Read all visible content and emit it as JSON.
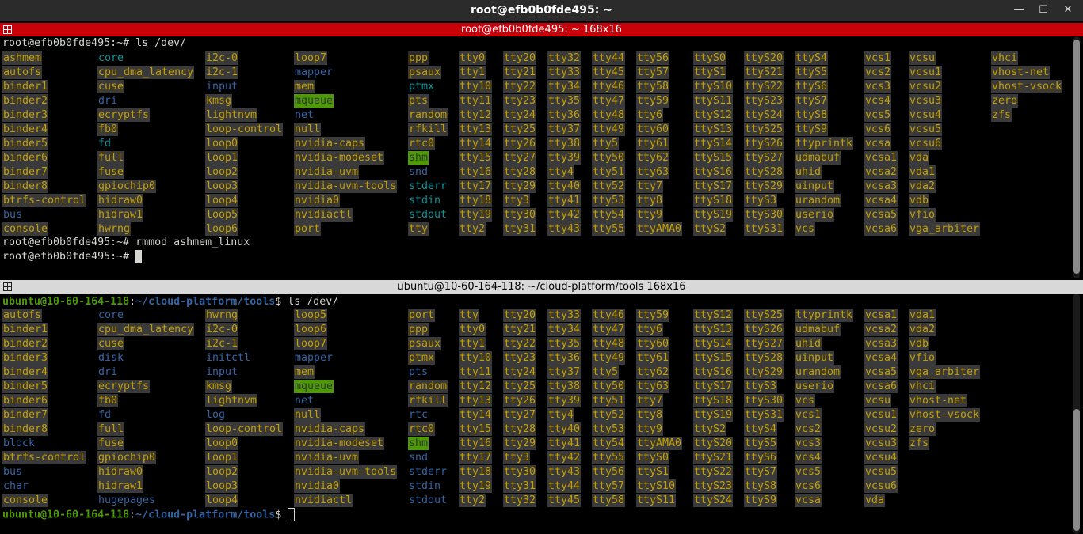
{
  "window": {
    "title": "root@efb0b0fde495: ~",
    "minimize_glyph": "—",
    "maximize_glyph": "☐",
    "close_glyph": "✕"
  },
  "pane1": {
    "header": "root@efb0b0fde495: ~ 168x16",
    "prompt1": "root@efb0b0fde495:~# ",
    "cmd1": "ls /dev/",
    "prompt2": "root@efb0b0fde495:~# ",
    "cmd2": "rmmod ashmem_linux",
    "prompt3": "root@efb0b0fde495:~# ",
    "cols": [
      [
        "ashmem",
        "autofs",
        "binder1",
        "binder2",
        "binder3",
        "binder4",
        "binder5",
        "binder6",
        "binder7",
        "binder8",
        "btrfs-control",
        "bus",
        "console"
      ],
      [
        "core",
        "cpu_dma_latency",
        "cuse",
        "dri",
        "ecryptfs",
        "fb0",
        "fd",
        "full",
        "fuse",
        "gpiochip0",
        "hidraw0",
        "hidraw1",
        "hwrng"
      ],
      [
        "i2c-0",
        "i2c-1",
        "input",
        "kmsg",
        "lightnvm",
        "loop-control",
        "loop0",
        "loop1",
        "loop2",
        "loop3",
        "loop4",
        "loop5",
        "loop6"
      ],
      [
        "loop7",
        "mapper",
        "mem",
        "mqueue",
        "net",
        "null",
        "nvidia-caps",
        "nvidia-modeset",
        "nvidia-uvm",
        "nvidia-uvm-tools",
        "nvidia0",
        "nvidiactl",
        "port"
      ],
      [
        "ppp",
        "psaux",
        "ptmx",
        "pts",
        "random",
        "rfkill",
        "rtc0",
        "shm",
        "snd",
        "stderr",
        "stdin",
        "stdout",
        "tty"
      ],
      [
        "tty0",
        "tty1",
        "tty10",
        "tty11",
        "tty12",
        "tty13",
        "tty14",
        "tty15",
        "tty16",
        "tty17",
        "tty18",
        "tty19",
        "tty2"
      ],
      [
        "tty20",
        "tty21",
        "tty22",
        "tty23",
        "tty24",
        "tty25",
        "tty26",
        "tty27",
        "tty28",
        "tty29",
        "tty3",
        "tty30",
        "tty31"
      ],
      [
        "tty32",
        "tty33",
        "tty34",
        "tty35",
        "tty36",
        "tty37",
        "tty38",
        "tty39",
        "tty4",
        "tty40",
        "tty41",
        "tty42",
        "tty43"
      ],
      [
        "tty44",
        "tty45",
        "tty46",
        "tty47",
        "tty48",
        "tty49",
        "tty5",
        "tty50",
        "tty51",
        "tty52",
        "tty53",
        "tty54",
        "tty55"
      ],
      [
        "tty56",
        "tty57",
        "tty58",
        "tty59",
        "tty6",
        "tty60",
        "tty61",
        "tty62",
        "tty63",
        "tty7",
        "tty8",
        "tty9",
        "ttyAMA0"
      ],
      [
        "ttyS0",
        "ttyS1",
        "ttyS10",
        "ttyS11",
        "ttyS12",
        "ttyS13",
        "ttyS14",
        "ttyS15",
        "ttyS16",
        "ttyS17",
        "ttyS18",
        "ttyS19",
        "ttyS2"
      ],
      [
        "ttyS20",
        "ttyS21",
        "ttyS22",
        "ttyS23",
        "ttyS24",
        "ttyS25",
        "ttyS26",
        "ttyS27",
        "ttyS28",
        "ttyS29",
        "ttyS3",
        "ttyS30",
        "ttyS31"
      ],
      [
        "ttyS4",
        "ttyS5",
        "ttyS6",
        "ttyS7",
        "ttyS8",
        "ttyS9",
        "ttyprintk",
        "udmabuf",
        "uhid",
        "uinput",
        "urandom",
        "userio",
        "vcs"
      ],
      [
        "vcs1",
        "vcs2",
        "vcs3",
        "vcs4",
        "vcs5",
        "vcs6",
        "vcsa",
        "vcsa1",
        "vcsa2",
        "vcsa3",
        "vcsa4",
        "vcsa5",
        "vcsa6"
      ],
      [
        "vcsu",
        "vcsu1",
        "vcsu2",
        "vcsu3",
        "vcsu4",
        "vcsu5",
        "vcsu6",
        "vda",
        "vda1",
        "vda2",
        "vdb",
        "vfio",
        "vga_arbiter"
      ],
      [
        "vhci",
        "vhost-net",
        "vhost-vsock",
        "zero",
        "zfs"
      ]
    ],
    "types": {
      "dir": [
        "bus",
        "dri",
        "input",
        "mapper",
        "net",
        "snd"
      ],
      "link": [
        "core",
        "fd",
        "ptmx",
        "stderr",
        "stdin",
        "stdout"
      ],
      "sticky": [
        "mqueue",
        "shm"
      ],
      "pipe": [
        "ppp"
      ]
    }
  },
  "pane2": {
    "header": "ubuntu@10-60-164-118: ~/cloud-platform/tools 168x16",
    "prompt_user": "ubuntu@10-60-164-118",
    "prompt_sep": ":",
    "prompt_path": "~/cloud-platform/tools",
    "prompt_end": "$ ",
    "cmd1": "ls /dev/",
    "cols": [
      [
        "autofs",
        "binder1",
        "binder2",
        "binder3",
        "binder4",
        "binder5",
        "binder6",
        "binder7",
        "binder8",
        "block",
        "btrfs-control",
        "bus",
        "char",
        "console"
      ],
      [
        "core",
        "cpu_dma_latency",
        "cuse",
        "disk",
        "dri",
        "ecryptfs",
        "fb0",
        "fd",
        "full",
        "fuse",
        "gpiochip0",
        "hidraw0",
        "hidraw1",
        "hugepages"
      ],
      [
        "hwrng",
        "i2c-0",
        "i2c-1",
        "initctl",
        "input",
        "kmsg",
        "lightnvm",
        "log",
        "loop-control",
        "loop0",
        "loop1",
        "loop2",
        "loop3",
        "loop4"
      ],
      [
        "loop5",
        "loop6",
        "loop7",
        "mapper",
        "mem",
        "mqueue",
        "net",
        "null",
        "nvidia-caps",
        "nvidia-modeset",
        "nvidia-uvm",
        "nvidia-uvm-tools",
        "nvidia0",
        "nvidiactl"
      ],
      [
        "port",
        "ppp",
        "psaux",
        "ptmx",
        "pts",
        "random",
        "rfkill",
        "rtc",
        "rtc0",
        "shm",
        "snd",
        "stderr",
        "stdin",
        "stdout"
      ],
      [
        "tty",
        "tty0",
        "tty1",
        "tty10",
        "tty11",
        "tty12",
        "tty13",
        "tty14",
        "tty15",
        "tty16",
        "tty17",
        "tty18",
        "tty19",
        "tty2"
      ],
      [
        "tty20",
        "tty21",
        "tty22",
        "tty23",
        "tty24",
        "tty25",
        "tty26",
        "tty27",
        "tty28",
        "tty29",
        "tty3",
        "tty30",
        "tty31",
        "tty32"
      ],
      [
        "tty33",
        "tty34",
        "tty35",
        "tty36",
        "tty37",
        "tty38",
        "tty39",
        "tty4",
        "tty40",
        "tty41",
        "tty42",
        "tty43",
        "tty44",
        "tty45"
      ],
      [
        "tty46",
        "tty47",
        "tty48",
        "tty49",
        "tty5",
        "tty50",
        "tty51",
        "tty52",
        "tty53",
        "tty54",
        "tty55",
        "tty56",
        "tty57",
        "tty58"
      ],
      [
        "tty59",
        "tty6",
        "tty60",
        "tty61",
        "tty62",
        "tty63",
        "tty7",
        "tty8",
        "tty9",
        "ttyAMA0",
        "ttyS0",
        "ttyS1",
        "ttyS10",
        "ttyS11"
      ],
      [
        "ttyS12",
        "ttyS13",
        "ttyS14",
        "ttyS15",
        "ttyS16",
        "ttyS17",
        "ttyS18",
        "ttyS19",
        "ttyS2",
        "ttyS20",
        "ttyS21",
        "ttyS22",
        "ttyS23",
        "ttyS24"
      ],
      [
        "ttyS25",
        "ttyS26",
        "ttyS27",
        "ttyS28",
        "ttyS29",
        "ttyS3",
        "ttyS30",
        "ttyS31",
        "ttyS4",
        "ttyS5",
        "ttyS6",
        "ttyS7",
        "ttyS8",
        "ttyS9"
      ],
      [
        "ttyprintk",
        "udmabuf",
        "uhid",
        "uinput",
        "urandom",
        "userio",
        "vcs",
        "vcs1",
        "vcs2",
        "vcs3",
        "vcs4",
        "vcs5",
        "vcs6",
        "vcsa"
      ],
      [
        "vcsa1",
        "vcsa2",
        "vcsa3",
        "vcsa4",
        "vcsa5",
        "vcsa6",
        "vcsu",
        "vcsu1",
        "vcsu2",
        "vcsu3",
        "vcsu4",
        "vcsu5",
        "vcsu6",
        "vda"
      ],
      [
        "vda1",
        "vda2",
        "vdb",
        "vfio",
        "vga_arbiter",
        "vhci",
        "vhost-net",
        "vhost-vsock",
        "zero",
        "zfs"
      ]
    ],
    "types": {
      "dir": [
        "block",
        "bus",
        "char",
        "core",
        "disk",
        "dri",
        "fd",
        "hugepages",
        "initctl",
        "input",
        "log",
        "mapper",
        "net",
        "pts",
        "rtc",
        "snd",
        "stderr",
        "stdin",
        "stdout"
      ],
      "link": [],
      "sticky": [
        "mqueue",
        "shm"
      ],
      "pipe": []
    }
  }
}
